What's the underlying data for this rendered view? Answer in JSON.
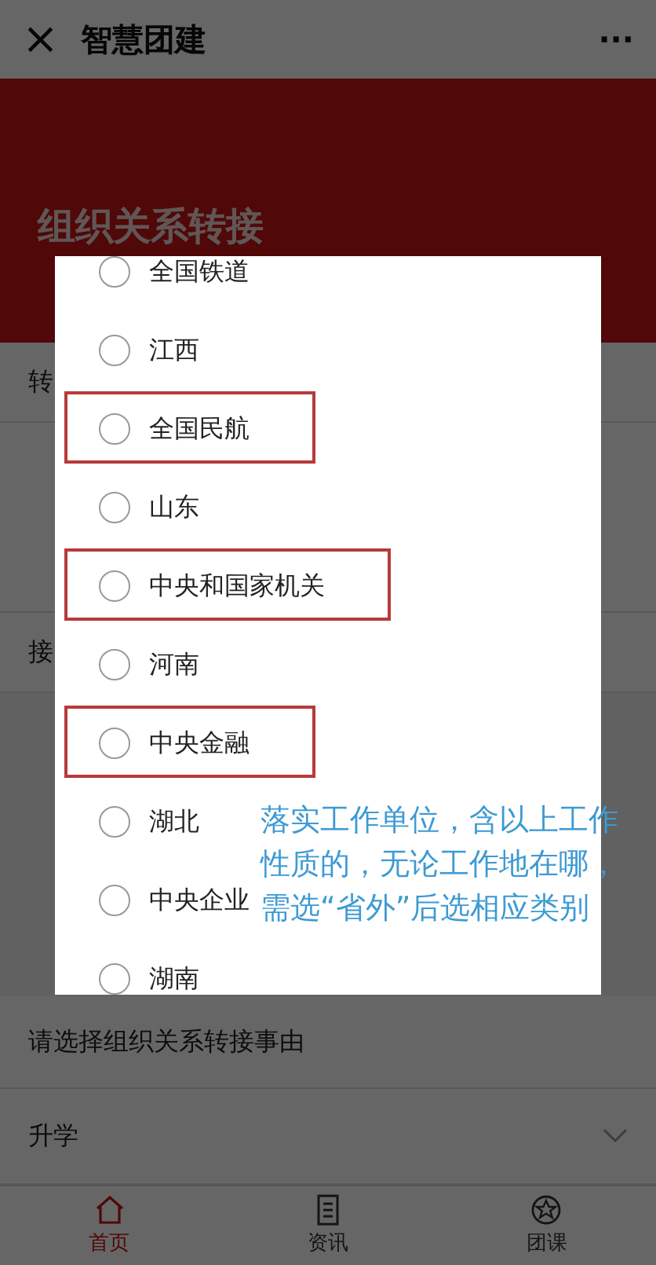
{
  "header": {
    "close": "×",
    "title": "智慧团建",
    "more": "···"
  },
  "banner": {
    "title": "组织关系转接"
  },
  "form": {
    "section_1": "转",
    "section_2": "接",
    "reason_label": "请选择组织关系转接事由",
    "reason_value": "升学"
  },
  "dialog": {
    "options": [
      {
        "label": "全国铁道",
        "selected": false,
        "highlighted": false
      },
      {
        "label": "江西",
        "selected": false,
        "highlighted": false
      },
      {
        "label": "全国民航",
        "selected": false,
        "highlighted": true
      },
      {
        "label": "山东",
        "selected": false,
        "highlighted": false
      },
      {
        "label": "中央和国家机关",
        "selected": false,
        "highlighted": true
      },
      {
        "label": "河南",
        "selected": false,
        "highlighted": false
      },
      {
        "label": "中央金融",
        "selected": false,
        "highlighted": true
      },
      {
        "label": "湖北",
        "selected": false,
        "highlighted": false
      },
      {
        "label": "中央企业",
        "selected": false,
        "highlighted": false
      },
      {
        "label": "湖南",
        "selected": false,
        "highlighted": false
      }
    ]
  },
  "annotation": "落实工作单位，含以上工作性质的，无论工作地在哪，需选“省外”后选相应类别",
  "tabbar": [
    {
      "label": "首页",
      "selected": true,
      "kind": "home"
    },
    {
      "label": "资讯",
      "selected": false,
      "kind": "news"
    },
    {
      "label": "团课",
      "selected": false,
      "kind": "course"
    }
  ]
}
